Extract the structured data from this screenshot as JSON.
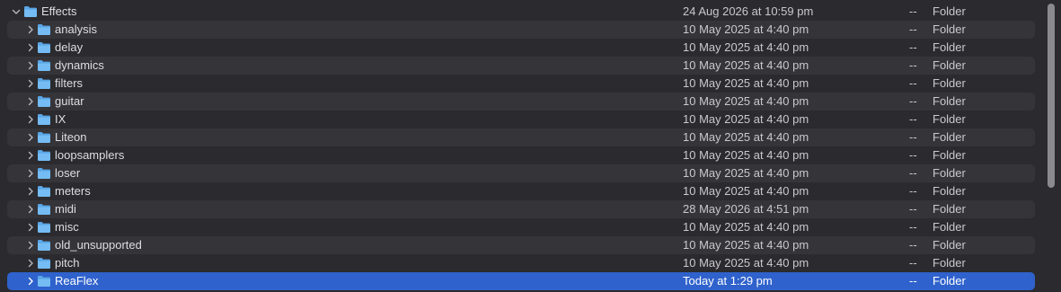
{
  "colors": {
    "background": "#2b2a2e",
    "row_alt": "#353439",
    "selected": "#2f62cc",
    "folder": "#6cb4ee",
    "text": "#dedde3"
  },
  "parent": {
    "name": "Effects",
    "date": "24 Aug 2026 at 10:59 pm",
    "size": "--",
    "kind": "Folder",
    "icon": "folder-icon",
    "disclosure": "chevron-down-icon"
  },
  "items": [
    {
      "name": "analysis",
      "date": "10 May 2025 at 4:40 pm",
      "size": "--",
      "kind": "Folder"
    },
    {
      "name": "delay",
      "date": "10 May 2025 at 4:40 pm",
      "size": "--",
      "kind": "Folder"
    },
    {
      "name": "dynamics",
      "date": "10 May 2025 at 4:40 pm",
      "size": "--",
      "kind": "Folder"
    },
    {
      "name": "filters",
      "date": "10 May 2025 at 4:40 pm",
      "size": "--",
      "kind": "Folder"
    },
    {
      "name": "guitar",
      "date": "10 May 2025 at 4:40 pm",
      "size": "--",
      "kind": "Folder"
    },
    {
      "name": "IX",
      "date": "10 May 2025 at 4:40 pm",
      "size": "--",
      "kind": "Folder"
    },
    {
      "name": "Liteon",
      "date": "10 May 2025 at 4:40 pm",
      "size": "--",
      "kind": "Folder"
    },
    {
      "name": "loopsamplers",
      "date": "10 May 2025 at 4:40 pm",
      "size": "--",
      "kind": "Folder"
    },
    {
      "name": "loser",
      "date": "10 May 2025 at 4:40 pm",
      "size": "--",
      "kind": "Folder"
    },
    {
      "name": "meters",
      "date": "10 May 2025 at 4:40 pm",
      "size": "--",
      "kind": "Folder"
    },
    {
      "name": "midi",
      "date": "28 May 2026 at 4:51 pm",
      "size": "--",
      "kind": "Folder"
    },
    {
      "name": "misc",
      "date": "10 May 2025 at 4:40 pm",
      "size": "--",
      "kind": "Folder"
    },
    {
      "name": "old_unsupported",
      "date": "10 May 2025 at 4:40 pm",
      "size": "--",
      "kind": "Folder"
    },
    {
      "name": "pitch",
      "date": "10 May 2025 at 4:40 pm",
      "size": "--",
      "kind": "Folder"
    },
    {
      "name": "ReaFlex",
      "date": "Today at 1:29 pm",
      "size": "--",
      "kind": "Folder",
      "selected": true
    }
  ]
}
